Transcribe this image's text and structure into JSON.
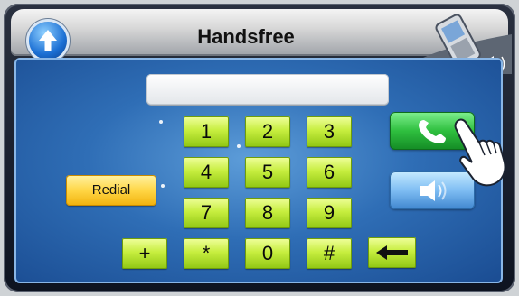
{
  "window": {
    "title": "Handsfree",
    "back_icon": "up-arrow-icon",
    "status_icon": "phone-signal-icon"
  },
  "number_display": {
    "value": ""
  },
  "keypad": {
    "keys": [
      "1",
      "2",
      "3",
      "4",
      "5",
      "6",
      "7",
      "8",
      "9",
      "*",
      "0",
      "#"
    ],
    "plus_label": "+",
    "backspace_icon": "backspace-arrow-icon"
  },
  "actions": {
    "redial_label": "Redial",
    "call_icon": "phone-handset-icon",
    "speaker_icon": "speaker-icon"
  },
  "colors": {
    "keypad_key": "#c7ee3f",
    "redial_button": "#ffd645",
    "call_button": "#2fbf3f",
    "speaker_button": "#7ebdf3",
    "screen_background": "#2f6eb6"
  }
}
